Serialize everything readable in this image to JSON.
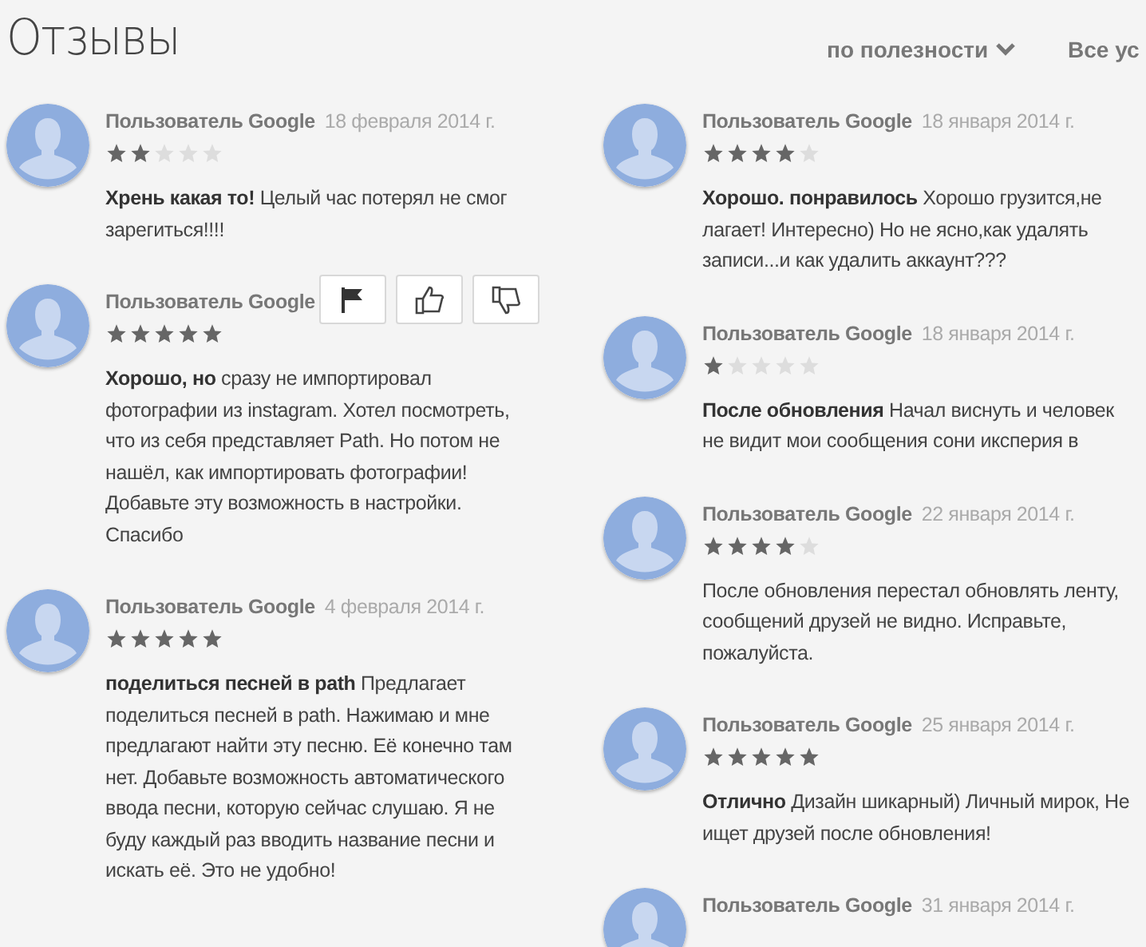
{
  "title": "Отзывы",
  "sort": {
    "label": "по полезности"
  },
  "filter": {
    "label": "Все ус"
  },
  "columns": [
    [
      {
        "author": "Пользователь Google",
        "date": "18 февраля 2014 г.",
        "stars": 2,
        "text": "**Хрень какая то!** Целый час потерял не смог зарегиться!!!!",
        "actions": false
      },
      {
        "author": "Пользователь Google",
        "stars": 5,
        "text": "**Хорошо, но** сразу не импортировал фотографии из instagram. Хотел посмотреть, что из себя представляет Path. Но потом не нашёл, как импортировать фотографии! Добавьте эту возможность в настройки. Спасибо",
        "actions": true
      },
      {
        "author": "Пользователь Google",
        "date": "4 февраля 2014 г.",
        "stars": 5,
        "text": "**поделиться песней в path** Предлагает поделиться песней в path. Нажимаю и мне предлагают найти эту песню. Её конечно там нет. Добавьте возможность автоматического ввода песни, которую сейчас слушаю. Я не буду каждый раз вводить название песни и искать её. Это не удобно!",
        "actions": false
      }
    ],
    [
      {
        "author": "Пользователь Google",
        "date": "18 января 2014 г.",
        "stars": 4,
        "text": "**Хорошо. понравилось** Хорошо грузится,не лагает! Интересно) Но не ясно,как удалять записи...и как удалить аккаунт???",
        "actions": false
      },
      {
        "author": "Пользователь Google",
        "date": "18 января 2014 г.",
        "stars": 1,
        "text": "**После обновления** Начал виснуть и человек не видит мои сообщения сони иксперия в",
        "actions": false
      },
      {
        "author": "Пользователь Google",
        "date": "22 января 2014 г.",
        "stars": 4,
        "text": "После обновления перестал обновлять ленту, сообщений друзей не видно. Исправьте, пожалуйста.",
        "actions": false
      },
      {
        "author": "Пользователь Google",
        "date": "25 января 2014 г.",
        "stars": 5,
        "text": "**Отлично** Дизайн шикарный) Личный мирок, Не ищет друзей после обновления!",
        "actions": false
      },
      {
        "author": "Пользователь Google",
        "date": "31 января 2014 г.",
        "actions": false
      }
    ]
  ]
}
